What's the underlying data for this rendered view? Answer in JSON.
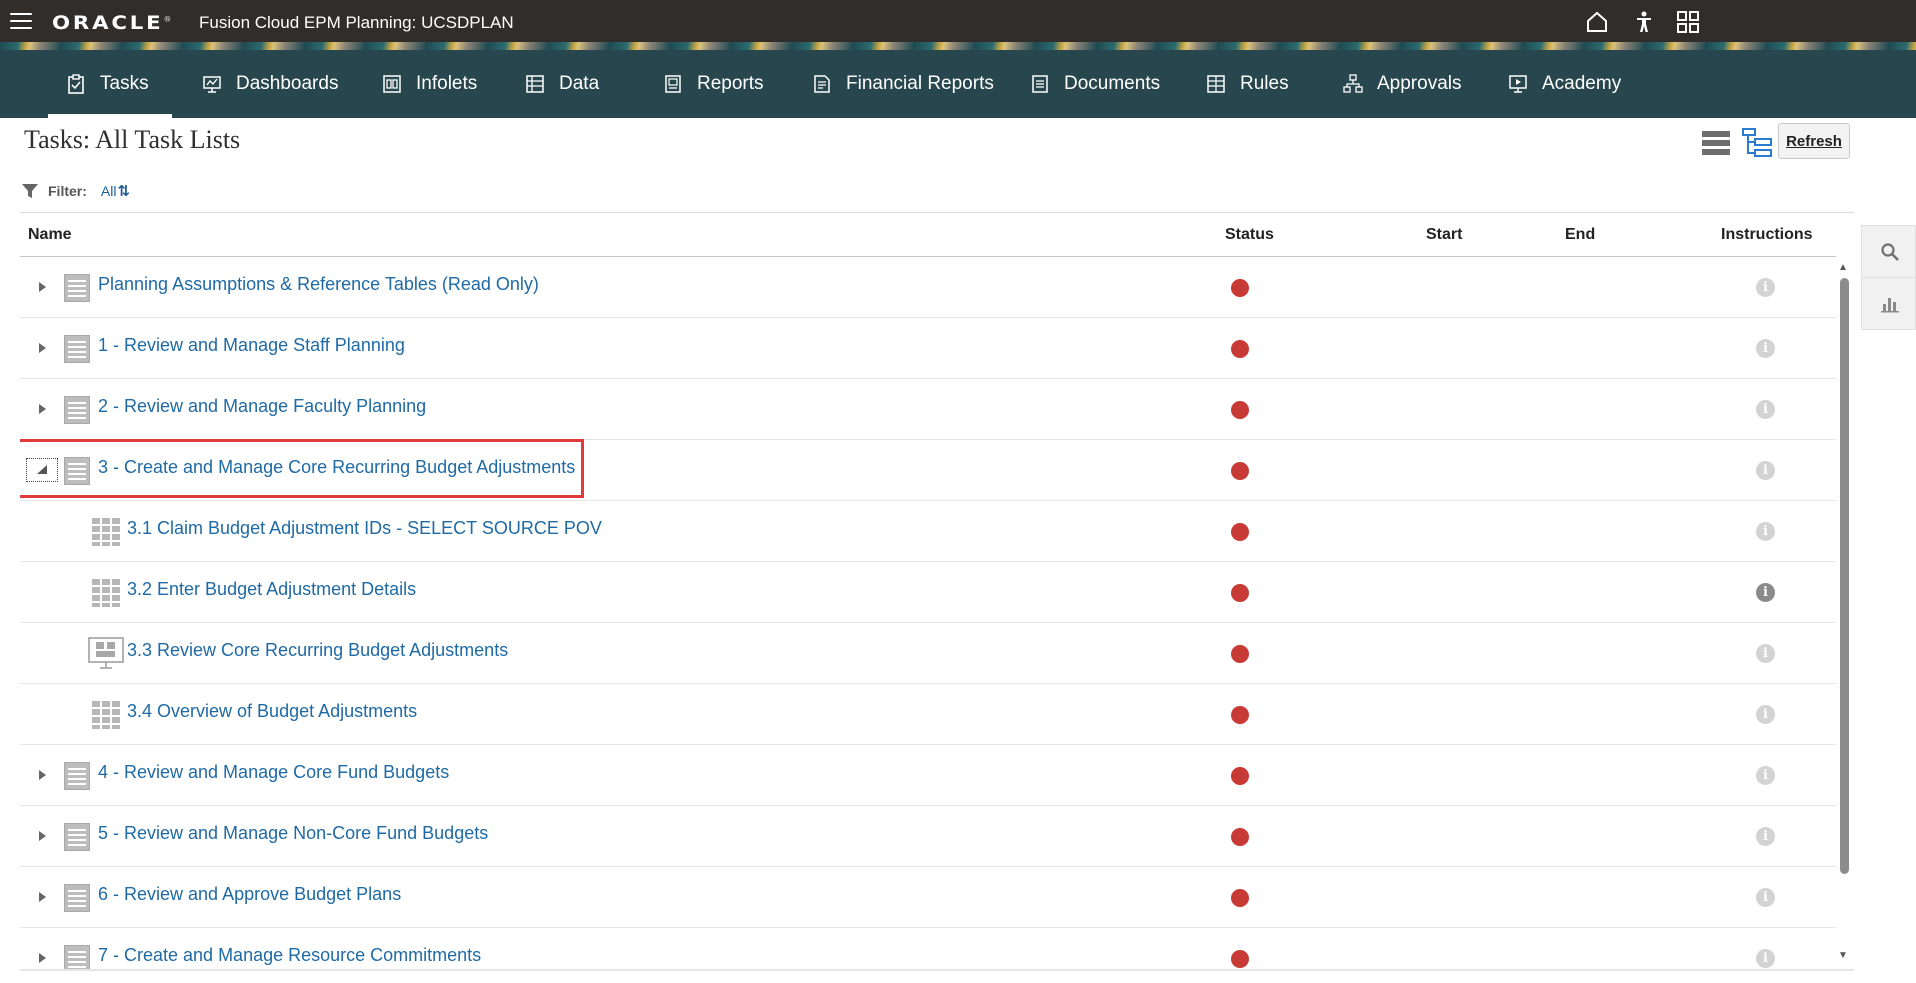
{
  "header": {
    "logo_text": "ORACLE",
    "app_title": "Fusion Cloud EPM Planning:  UCSDPLAN",
    "icons": [
      "home-icon",
      "accessibility-icon",
      "navigator-grid-icon"
    ]
  },
  "nav": {
    "items": [
      {
        "label": "Tasks",
        "icon": "clipboard-icon",
        "active": true
      },
      {
        "label": "Dashboards",
        "icon": "dashboard-icon"
      },
      {
        "label": "Infolets",
        "icon": "infolets-icon"
      },
      {
        "label": "Data",
        "icon": "data-icon"
      },
      {
        "label": "Reports",
        "icon": "reports-icon"
      },
      {
        "label": "Financial Reports",
        "icon": "financial-reports-icon"
      },
      {
        "label": "Documents",
        "icon": "documents-icon"
      },
      {
        "label": "Rules",
        "icon": "rules-icon"
      },
      {
        "label": "Approvals",
        "icon": "approvals-icon"
      },
      {
        "label": "Academy",
        "icon": "academy-icon"
      }
    ]
  },
  "page": {
    "title": "Tasks: All Task Lists",
    "refresh_label": "Refresh",
    "filter_label": "Filter:",
    "filter_value": "All"
  },
  "table": {
    "columns": [
      "Name",
      "Status",
      "Start",
      "End",
      "Instructions"
    ],
    "rows": [
      {
        "name": "Planning Assumptions & Reference Tables (Read Only)",
        "level": 0,
        "type": "task-list",
        "expanded": false
      },
      {
        "name": "1 - Review and Manage Staff Planning",
        "level": 0,
        "type": "task-list",
        "expanded": false
      },
      {
        "name": "2 - Review and Manage Faculty Planning",
        "level": 0,
        "type": "task-list",
        "expanded": false
      },
      {
        "name": "3 - Create and Manage Core Recurring Budget Adjustments",
        "level": 0,
        "type": "task-list",
        "expanded": true,
        "highlighted": true
      },
      {
        "name": "3.1 Claim Budget Adjustment IDs - SELECT SOURCE POV",
        "level": 1,
        "type": "form"
      },
      {
        "name": "3.2 Enter Budget Adjustment Details",
        "level": 1,
        "type": "form",
        "instructions_active": true
      },
      {
        "name": "3.3 Review Core Recurring Budget Adjustments",
        "level": 1,
        "type": "dashboard"
      },
      {
        "name": "3.4 Overview of Budget Adjustments",
        "level": 1,
        "type": "form"
      },
      {
        "name": "4 - Review and Manage Core Fund Budgets",
        "level": 0,
        "type": "task-list",
        "expanded": false
      },
      {
        "name": "5 - Review and Manage Non-Core Fund Budgets",
        "level": 0,
        "type": "task-list",
        "expanded": false
      },
      {
        "name": "6 - Review and Approve Budget Plans",
        "level": 0,
        "type": "task-list",
        "expanded": false
      },
      {
        "name": "7 - Create and Manage Resource Commitments",
        "level": 0,
        "type": "task-list",
        "expanded": false
      }
    ],
    "status_color": "#c83a36"
  },
  "side_panel": {
    "icons": [
      "search-icon",
      "chart-icon"
    ]
  },
  "colors": {
    "header_bg": "#312d2a",
    "nav_bg": "#28464e",
    "link": "#1f6aa5",
    "highlight": "#e03a3a"
  }
}
